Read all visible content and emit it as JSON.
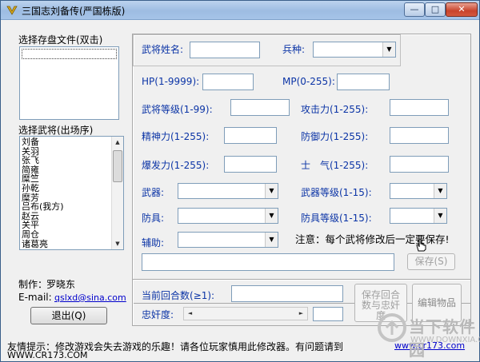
{
  "window": {
    "title": "三国志刘备传(严国栋版)",
    "controls": {
      "minimize": "—",
      "maximize": "□",
      "close": "✕"
    }
  },
  "left": {
    "save_file_label": "选择存盘文件(双击)",
    "general_select_label": "选择武将(出场序)",
    "generals": [
      "刘备",
      "关羽",
      "张飞",
      "简雍",
      "糜竺",
      "孙乾",
      "糜芳",
      "吕布(我方)",
      "赵云",
      "关平",
      "周仓",
      "诸葛亮"
    ],
    "author_label": "制作：",
    "author": "罗晓东",
    "email_label": "E-mail:",
    "email": "qslxd@sina.com",
    "exit_label": "退出(Q)"
  },
  "main": {
    "general_name_label": "武将姓名:",
    "unit_type_label": "兵种:",
    "hp_label": "HP(1-9999):",
    "mp_label": "MP(0-255):",
    "level_label": "武将等级(1-99):",
    "attack_label": "攻击力(1-255):",
    "spirit_label": "精神力(1-255):",
    "defense_label": "防御力(1-255):",
    "burst_label": "爆发力(1-255):",
    "morale_label": "士　气(1-255):",
    "weapon_label": "武器:",
    "weapon_level_label": "武器等级(1-15):",
    "armor_label": "防具:",
    "armor_level_label": "防具等级(1-15):",
    "aux_label": "辅助:",
    "notice": "注意：每个武将修改后一定要保存!",
    "save_label": "保存(S)"
  },
  "bottom": {
    "round_label": "当前回合数(≥1):",
    "loyalty_label": "忠奸度:",
    "save_round_label": "保存回合数与忠奸度",
    "edit_items_label": "编辑物品"
  },
  "footer": {
    "tip": "友情提示：修改游戏会失去游戏的乐趣！请各位玩家慎用此修改器。有问题请到",
    "site_link": "www.cr173.com",
    "site_text": "WWW.CR173.COM"
  },
  "watermark": {
    "brand": "当下软件园",
    "url": "WWW.DOWNXIA.COM"
  }
}
